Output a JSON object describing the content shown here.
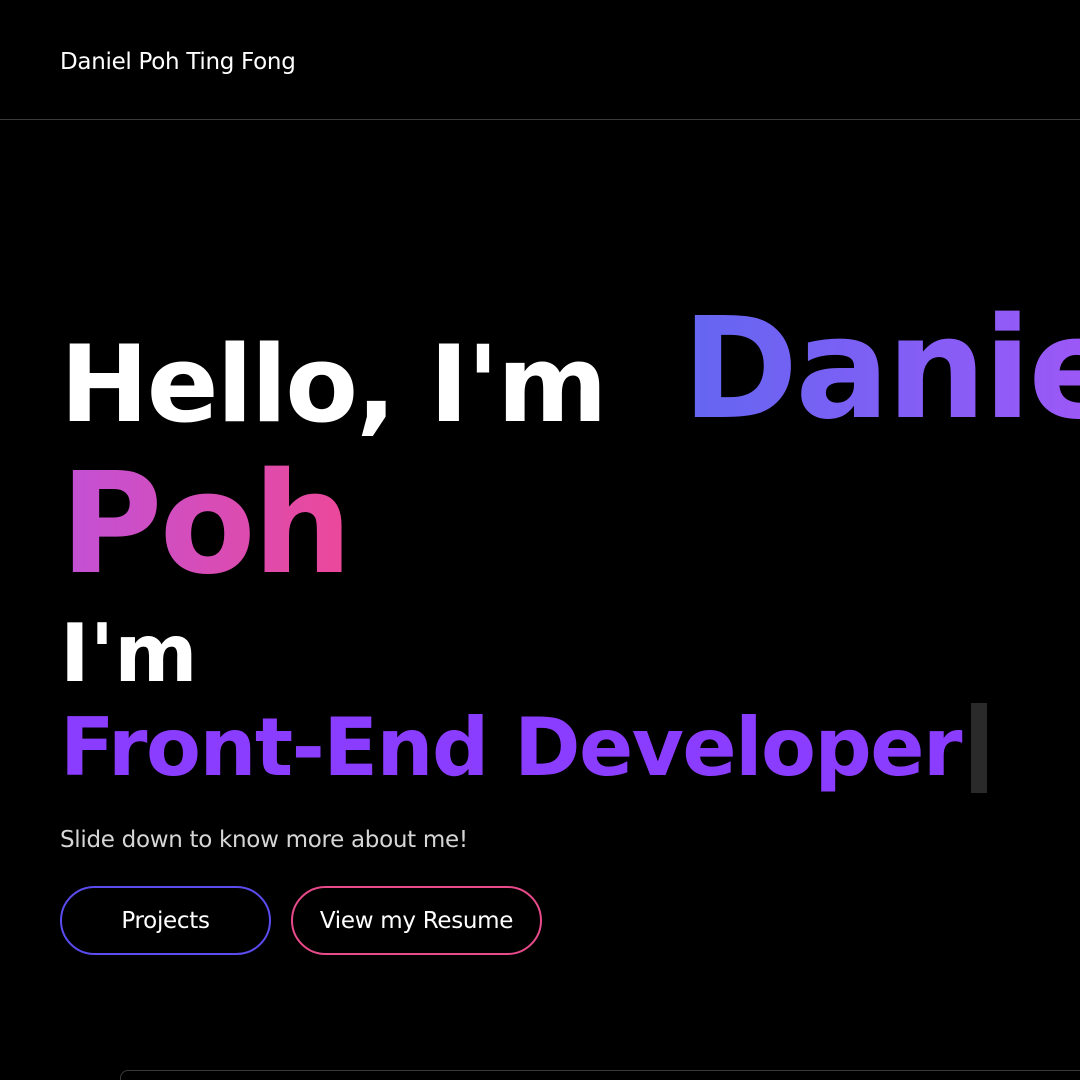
{
  "header": {
    "brand": "Daniel Poh Ting Fong"
  },
  "hero": {
    "greeting": "Hello, I'm",
    "first_name": "Daniel",
    "last_name": "Poh",
    "role_prefix": "I'm",
    "role": "Front-End Developer",
    "tagline": "Slide down to know more about me!"
  },
  "actions": {
    "projects_label": "Projects",
    "resume_label": "View my Resume"
  },
  "colors": {
    "background": "#000000",
    "accent_indigo": "#6366f1",
    "accent_purple": "#8b3dff",
    "accent_pink": "#ec4899"
  }
}
